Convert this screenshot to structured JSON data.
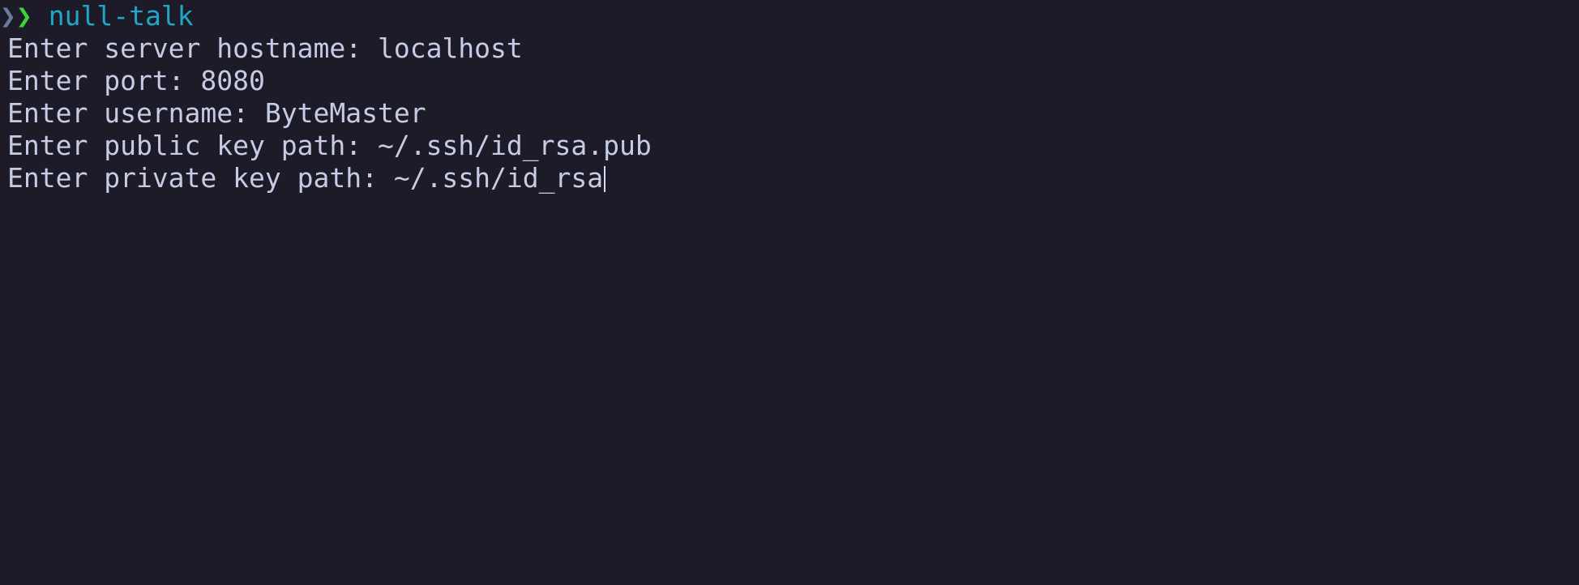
{
  "prompt": {
    "left_glyph": "❯",
    "arrow_glyph": "❯",
    "command": "null-talk"
  },
  "output": [
    {
      "label": "Enter server hostname: ",
      "value": "localhost"
    },
    {
      "label": "Enter port: ",
      "value": "8080"
    },
    {
      "label": "Enter username: ",
      "value": "ByteMaster"
    },
    {
      "label": "Enter public key path: ",
      "value": "~/.ssh/id_rsa.pub"
    },
    {
      "label": "Enter private key path: ",
      "value": "~/.ssh/id_rsa"
    }
  ],
  "colors": {
    "background": "#1c1b27",
    "text": "#c6cbe6",
    "command": "#1fa7c7",
    "prompt_arrow": "#3fd13a"
  }
}
